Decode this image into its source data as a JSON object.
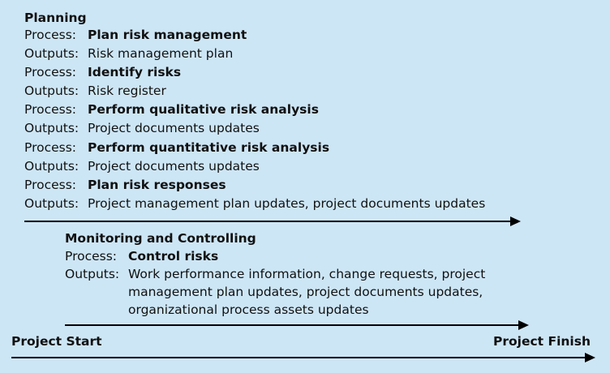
{
  "planning": {
    "heading": "Planning",
    "rows": [
      {
        "label": "Process:",
        "value": "Plan risk management"
      },
      {
        "label": "Outputs:",
        "value": "Risk management plan"
      },
      {
        "label": "Process:",
        "value": "Identify risks"
      },
      {
        "label": "Outputs:",
        "value": "Risk register"
      },
      {
        "label": "Process:",
        "value": "Perform qualitative risk analysis"
      },
      {
        "label": "Outputs:",
        "value": "Project documents updates"
      },
      {
        "label": "Process:",
        "value": "Perform quantitative risk analysis"
      },
      {
        "label": "Outputs:",
        "value": "Project documents updates"
      },
      {
        "label": "Process:",
        "value": "Plan risk responses"
      },
      {
        "label": "Outputs:",
        "value": "Project management plan updates, project documents updates"
      }
    ]
  },
  "monitoring": {
    "heading": "Monitoring and Controlling",
    "process_label": "Process:",
    "process_value": "Control risks",
    "outputs_label": "Outputs:",
    "outputs_lines": [
      "Work performance information, change requests, project",
      "management plan updates, project documents updates,",
      "organizational process assets updates"
    ]
  },
  "timeline": {
    "start_label": "Project Start",
    "finish_label": "Project Finish"
  }
}
